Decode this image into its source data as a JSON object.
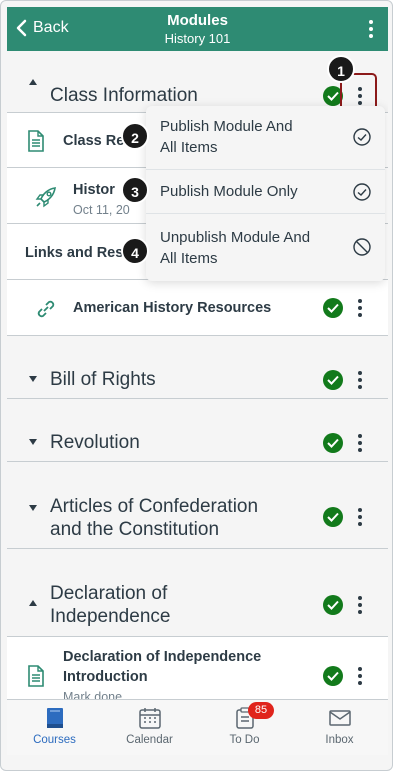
{
  "header": {
    "back_label": "Back",
    "title": "Modules",
    "subtitle": "History 101"
  },
  "modules": [
    {
      "title": "Class Information",
      "state": "expanded",
      "published": true
    },
    {
      "title": "Bill of Rights",
      "state": "collapsed",
      "published": true
    },
    {
      "title": "Revolution",
      "state": "collapsed",
      "published": true
    },
    {
      "title": "Articles of Confederation and the Constitution",
      "title_line1": "Articles of Confederation",
      "title_line2": "and the Constitution",
      "state": "collapsed",
      "published": true
    },
    {
      "title": "Declaration of Independence",
      "title_line1": "Declaration of",
      "title_line2": "Independence",
      "state": "expanded",
      "published": true
    }
  ],
  "items": [
    {
      "title": "Class Re",
      "icon": "document-icon"
    },
    {
      "title": "Histor",
      "subtitle": "Oct 11, 20",
      "icon": "rocket-icon"
    },
    {
      "title": "Links and Reso",
      "type": "subheader"
    },
    {
      "title": "American History Resources",
      "icon": "link-icon",
      "published": true
    },
    {
      "title_line1": "Declaration of Independence",
      "title_line2": "Introduction",
      "subtitle": "Mark done",
      "icon": "document-icon",
      "published": true
    }
  ],
  "popup_menu": {
    "options": [
      {
        "label_line1": "Publish Module And",
        "label_line2": "All Items",
        "icon": "check-circle-icon"
      },
      {
        "label": "Publish Module Only",
        "icon": "check-circle-icon"
      },
      {
        "label_line1": "Unpublish Module And",
        "label_line2": "All Items",
        "icon": "no-entry-icon"
      }
    ]
  },
  "markers": [
    "1",
    "2",
    "3",
    "4"
  ],
  "tabbar": {
    "tabs": [
      {
        "label": "Courses",
        "icon": "book-icon",
        "active": true
      },
      {
        "label": "Calendar",
        "icon": "calendar-icon"
      },
      {
        "label": "To Do",
        "icon": "clipboard-icon",
        "badge": "85"
      },
      {
        "label": "Inbox",
        "icon": "envelope-icon"
      }
    ]
  },
  "colors": {
    "header_bg": "#2e8b73",
    "published_green": "#127a1b",
    "active_tab": "#2d6cbf",
    "badge_red": "#e0241c",
    "highlight_border": "#8c1a1a"
  }
}
